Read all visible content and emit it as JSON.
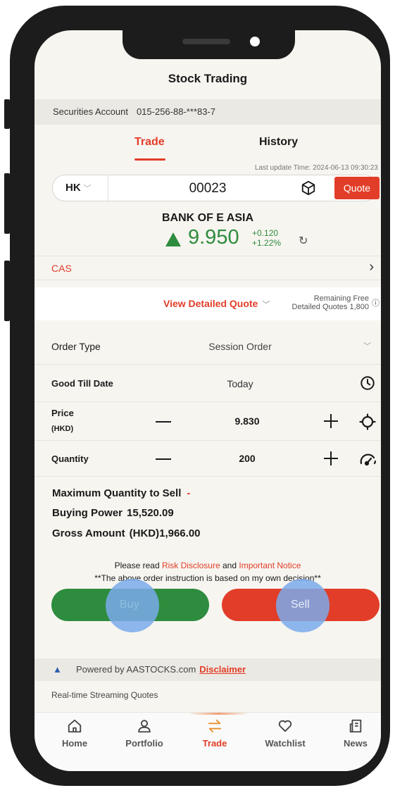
{
  "header": {
    "title": "Stock Trading"
  },
  "account": {
    "label": "Securities Account",
    "number": "015-256-88-***83-7"
  },
  "tabs": [
    {
      "label": "Trade",
      "active": true
    },
    {
      "label": "History",
      "active": false
    }
  ],
  "last_update": "Last update Time: 2024-06-13 09:30:23",
  "search": {
    "market": "HK",
    "code": "00023",
    "quote_label": "Quote"
  },
  "stock": {
    "name": "BANK OF E ASIA",
    "price": "9.950",
    "change": "+0.120",
    "change_pct": "+1.22%",
    "trend": "up"
  },
  "cas": {
    "label": "CAS"
  },
  "detailed_quote": {
    "link": "View Detailed Quote",
    "remaining_line1": "Remaining Free",
    "remaining_line2": "Detailed Quotes 1,800"
  },
  "order": {
    "type_label": "Order Type",
    "type_value": "Session Order",
    "gtd_label": "Good Till Date",
    "gtd_value": "Today",
    "price_label": "Price",
    "price_unit": "(HKD)",
    "price_value": "9.830",
    "qty_label": "Quantity",
    "qty_value": "200"
  },
  "summary": {
    "max_qty_label": "Maximum Quantity to Sell",
    "max_qty_value": "-",
    "buying_power_label": "Buying Power",
    "buying_power_value": "15,520.09",
    "gross_label": "Gross Amount",
    "gross_value": "(HKD)1,966.00"
  },
  "notice": {
    "prefix": "Please read ",
    "risk": "Risk Disclosure",
    "and": " and ",
    "important": "Important Notice",
    "line2": "**The above order instruction is based on my own decision**"
  },
  "actions": {
    "buy": "Buy",
    "sell": "Sell"
  },
  "footer": {
    "powered": "Powered by AASTOCKS.com",
    "disclaimer": "Disclaimer",
    "streaming": "Real-time Streaming Quotes"
  },
  "nav": [
    {
      "label": "Home",
      "icon": "home-icon"
    },
    {
      "label": "Portfolio",
      "icon": "person-icon"
    },
    {
      "label": "Trade",
      "icon": "swap-arrows-icon",
      "active": true
    },
    {
      "label": "Watchlist",
      "icon": "heart-icon"
    },
    {
      "label": "News",
      "icon": "newspaper-icon"
    }
  ],
  "colors": {
    "accent": "#e23d28",
    "up": "#2e8c3e",
    "sell": "#e23d28",
    "buy": "#2e8c3e"
  }
}
